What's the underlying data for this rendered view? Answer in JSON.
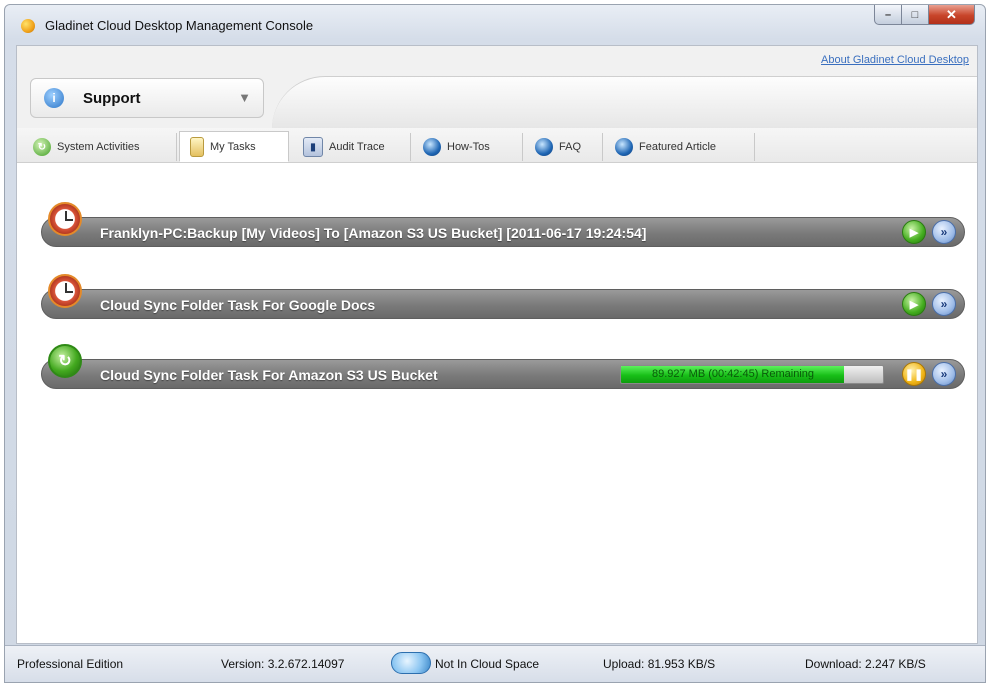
{
  "window": {
    "title": "Gladinet Cloud Desktop Management Console",
    "minimize": "–",
    "maximize": "□",
    "close": "✕"
  },
  "header": {
    "about_link": "About Gladinet Cloud Desktop",
    "support": {
      "label": "Support",
      "icon": "info-icon",
      "arrow": "▼"
    }
  },
  "tabs": [
    {
      "label": "System Activities",
      "icon": "activity-icon"
    },
    {
      "label": "My Tasks",
      "icon": "tasks-icon",
      "active": true
    },
    {
      "label": "Audit Trace",
      "icon": "audit-icon"
    },
    {
      "label": "How-Tos",
      "icon": "globe-icon"
    },
    {
      "label": "FAQ",
      "icon": "globe-icon"
    },
    {
      "label": "Featured Article",
      "icon": "globe-icon"
    }
  ],
  "tasks": [
    {
      "title": "Franklyn-PC:Backup [My Videos] To [Amazon S3 US Bucket] [2011-06-17 19:24:54]",
      "icon": "clock-icon",
      "action": "play"
    },
    {
      "title": "Cloud Sync Folder Task For Google Docs",
      "icon": "clock-icon",
      "action": "play"
    },
    {
      "title": "Cloud Sync Folder Task For Amazon S3 US Bucket",
      "icon": "sync-icon",
      "action": "pause",
      "progress": {
        "text": "89.927 MB (00:42:45) Remaining",
        "fraction": 0.85
      }
    }
  ],
  "status": {
    "edition": "Professional Edition",
    "version": "Version: 3.2.672.14097",
    "cloud_space": "Not In Cloud Space",
    "upload": "Upload: 81.953 KB/S",
    "download": "Download: 2.247 KB/S"
  },
  "colors": {
    "task_bar": "#7a7a7a",
    "progress_green": "#18c018",
    "link_blue": "#3a6fbf"
  }
}
